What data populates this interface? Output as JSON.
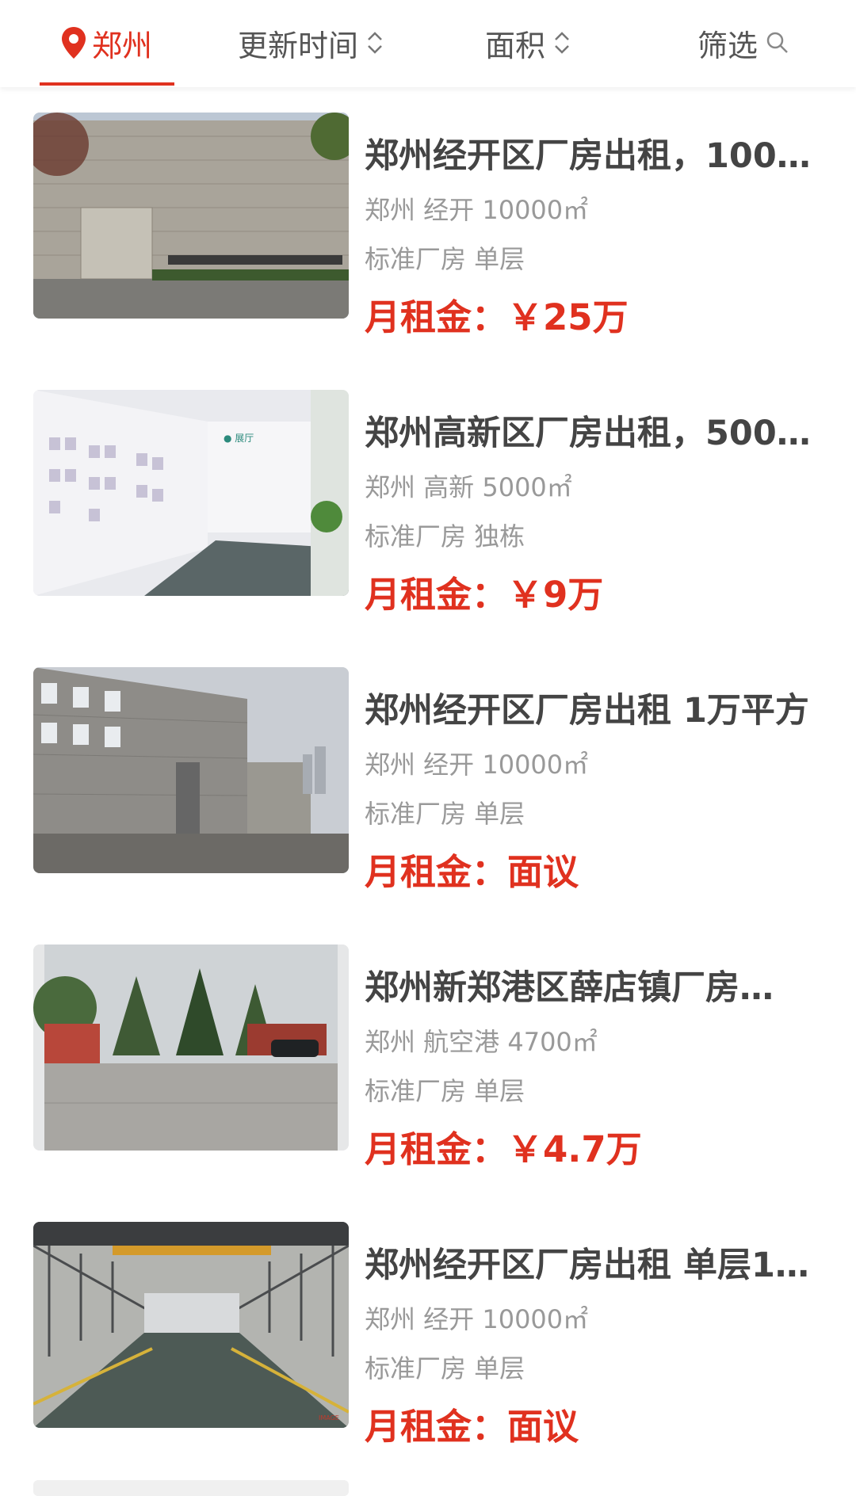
{
  "filters": {
    "city": "郑州",
    "update_time": "更新时间",
    "area": "面积",
    "filter": "筛选"
  },
  "listings": [
    {
      "title": "郑州经开区厂房出租，100…",
      "location": "郑州 经开 10000㎡",
      "type": "标准厂房 单层",
      "price": "月租金：￥25万"
    },
    {
      "title": "郑州高新区厂房出租，500…",
      "location": "郑州 高新 5000㎡",
      "type": "标准厂房 独栋",
      "price": "月租金：￥9万"
    },
    {
      "title": "郑州经开区厂房出租 1万平方",
      "location": "郑州 经开 10000㎡",
      "type": "标准厂房 单层",
      "price": "月租金：面议"
    },
    {
      "title": "郑州新郑港区薛店镇厂房…",
      "location": "郑州 航空港 4700㎡",
      "type": "标准厂房 单层",
      "price": "月租金：￥4.7万"
    },
    {
      "title": "郑州经开区厂房出租 单层1…",
      "location": "郑州 经开 10000㎡",
      "type": "标准厂房 单层",
      "price": "月租金：面议"
    }
  ],
  "colors": {
    "accent": "#e0311f",
    "title": "#444444",
    "meta": "#999999"
  },
  "icons": {
    "city": "location-pin-icon",
    "sort": "sort-arrows-icon",
    "filter": "search-icon"
  }
}
